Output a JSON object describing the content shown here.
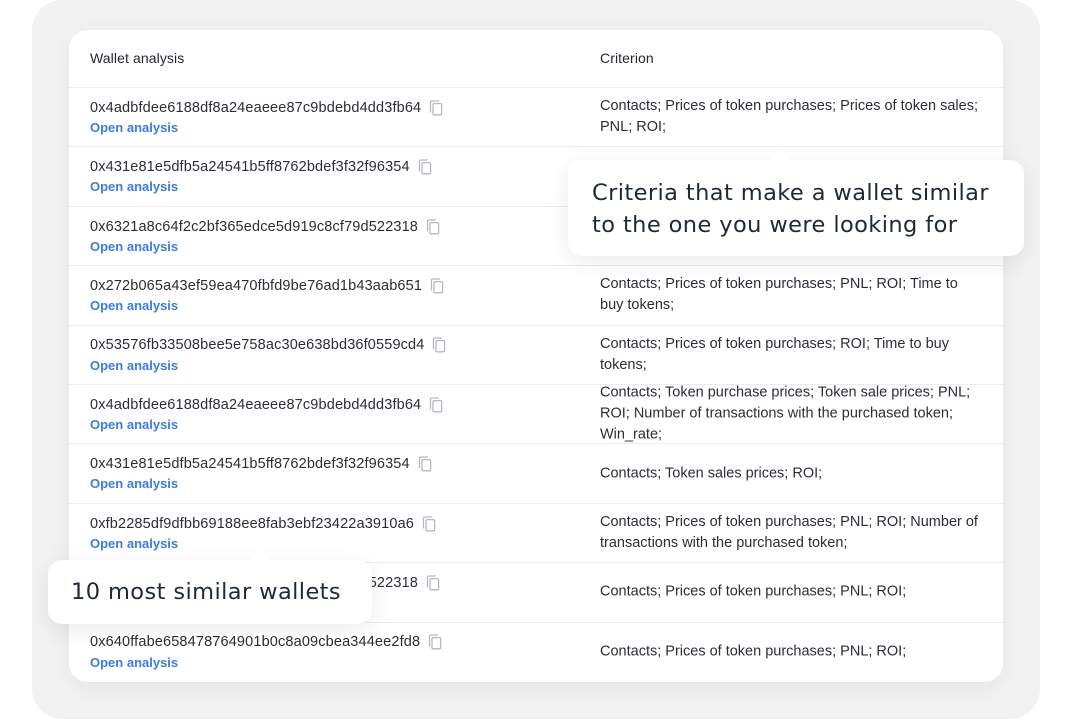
{
  "table": {
    "headers": {
      "wallet": "Wallet analysis",
      "criterion": "Criterion"
    },
    "open_link_label": "Open analysis",
    "rows": [
      {
        "address": "0x4adbfdee6188df8a24eaeee87c9bdebd4dd3fb64",
        "link": "Open analysis",
        "criterion": "Contacts; Prices of token purchases; Prices of token sales; PNL; ROI;"
      },
      {
        "address": "0x431e81e5dfb5a24541b5ff8762bdef3f32f96354",
        "link": "Open analysis",
        "criterion": ""
      },
      {
        "address": "0x6321a8c64f2c2bf365edce5d919c8cf79d522318",
        "link": "Open analysis",
        "criterion": ""
      },
      {
        "address": "0x272b065a43ef59ea470fbfd9be76ad1b43aab651",
        "link": "Open analysis",
        "criterion": "Contacts; Prices of token purchases; PNL; ROI; Time to buy tokens;"
      },
      {
        "address": "0x53576fb33508bee5e758ac30e638bd36f0559cd4",
        "link": "Open analysis",
        "criterion": "Contacts; Prices of token purchases; ROI; Time to buy tokens;"
      },
      {
        "address": "0x4adbfdee6188df8a24eaeee87c9bdebd4dd3fb64",
        "link": "Open analysis",
        "criterion": "Contacts; Token purchase prices; Token sale prices; PNL; ROI; Number of transactions with the purchased token; Win_rate;"
      },
      {
        "address": "0x431e81e5dfb5a24541b5ff8762bdef3f32f96354",
        "link": "Open analysis",
        "criterion": "Contacts; Token sales prices; ROI;"
      },
      {
        "address": "0xfb2285df9dfbb69188ee8fab3ebf23422a3910a6",
        "link": "Open analysis",
        "criterion": "Contacts; Prices of token purchases; PNL; ROI; Number of transactions with the purchased token;"
      },
      {
        "address": "0x6321a8c64f2c2bf365edce5d919c8cf79d522318",
        "link": "Open analysis",
        "criterion": "Contacts; Prices of token purchases; PNL; ROI;"
      },
      {
        "address": "0x640ffabe658478764901b0c8a09cbea344ee2fd8",
        "link": "Open analysis",
        "criterion": "Contacts; Prices of token purchases; PNL; ROI;"
      }
    ]
  },
  "tooltips": {
    "criteria": "Criteria that make a wallet similar to the one you were looking for",
    "wallets": "10 most similar wallets"
  },
  "icons": {
    "copy": "copy-icon"
  },
  "colors": {
    "link": "#3a7beb",
    "text": "#2a2e35",
    "panel_bg": "#f2f2f3",
    "divider": "#ececee"
  }
}
